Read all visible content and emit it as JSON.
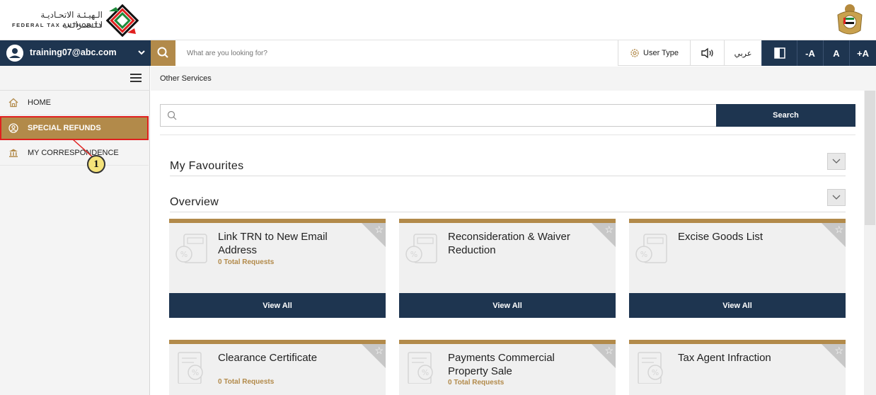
{
  "header": {
    "logo_arabic": "الـهيـئـة الاتحـاديـة لـلـضـرائـب",
    "logo_english": "FEDERAL TAX AUTHORITY"
  },
  "toolbar": {
    "user_email": "training07@abc.com",
    "search_placeholder": "What are you looking for?",
    "user_type_label": "User Type",
    "arabic_label": "عربي",
    "font_decrease": "-A",
    "font_normal": "A",
    "font_increase": "+A"
  },
  "sidebar": {
    "items": [
      {
        "label": "HOME",
        "icon": "home-icon"
      },
      {
        "label": "SPECIAL REFUNDS",
        "icon": "user-circle-icon",
        "active": true
      },
      {
        "label": "MY CORRESPONDENCE",
        "icon": "bank-icon"
      }
    ],
    "annotation_number": "1"
  },
  "main": {
    "breadcrumb": "Other Services",
    "search_button": "Search",
    "sections": {
      "favourites": "My Favourites",
      "overview": "Overview"
    },
    "cards": [
      {
        "title": "Link TRN to New Email Address",
        "subtitle": "0 Total Requests",
        "button": "View All"
      },
      {
        "title": "Reconsideration & Waiver Reduction",
        "subtitle": "",
        "button": "View All"
      },
      {
        "title": "Excise Goods List",
        "subtitle": "",
        "button": "View All"
      },
      {
        "title": "Clearance Certificate",
        "subtitle": "0 Total Requests"
      },
      {
        "title": "Payments Commercial Property Sale",
        "subtitle": "0 Total Requests"
      },
      {
        "title": "Tax Agent Infraction",
        "subtitle": ""
      }
    ]
  },
  "colors": {
    "navy": "#1e3550",
    "gold": "#b28a4a",
    "highlight_border": "#e0201f"
  }
}
